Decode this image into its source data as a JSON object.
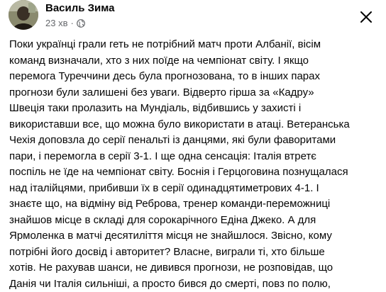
{
  "post": {
    "author": "Василь Зима",
    "time": "23 хв",
    "separator": "·",
    "privacy_icon": "globe-icon",
    "close_icon": "close-icon",
    "lines": [
      "Поки українці грали геть не потрібний матч проти Албанії, вісім",
      "команд визначали, хто з них поїде на чемпіонат світу. І якщо",
      "перемога Туреччини десь була прогнозована, то в інших парах",
      "прогнози були залишені без уваги. Відверто гірша за «Кадру»",
      "Швеція таки пролазить на Мундіаль, відбившись у захисті і",
      "використавши все, що можна було використати в атаці. Ветеранська",
      "Чехія доповзла до серії пенальті із данцями, які були фаворитами",
      "пари, і перемогла в серії 3-1. І ще одна сенсація: Італія втретє",
      "поспіль не їде на чемпіонат світу. Боснія і Герцоговина познущалася",
      "над італійцями, прибивши їх в серії одинадцятиметрових 4-1. І",
      "знаєте що, на відміну від Реброва, тренер команди-переможниці",
      "знайшов місце в складі для сорокарічного Едіна Джеко. А для",
      "Ярмоленка в матчі десятиліття місця не знайшлося. Звісно, кому",
      "потрібні його досвід і авторитет? Власне, виграли ті, хто більше",
      "хотів. Не рахував шанси, не дивився прогнози, не розповідав, що",
      "Данія чи Італія сильніші, а просто бився до смерті, повз по полю,"
    ]
  },
  "colors": {
    "text": "#050505",
    "secondary": "#65676b",
    "background": "#ffffff"
  }
}
